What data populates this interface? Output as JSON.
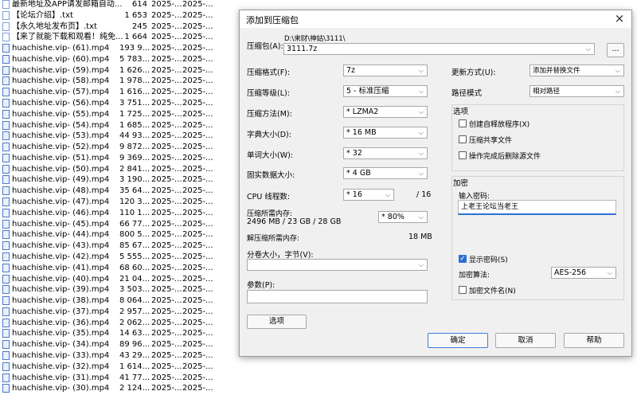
{
  "files": [
    {
      "name": "最新地址及APP请发邮箱自动...",
      "size": "614",
      "date": "2025-...",
      "date2": "2025-...",
      "type": "txt"
    },
    {
      "name": "【论坛介绍】.txt",
      "size": "1 653",
      "date": "2025-...",
      "date2": "2025-...",
      "type": "txt"
    },
    {
      "name": "【永久地址发布页】.txt",
      "size": "245",
      "date": "2025-...",
      "date2": "2025-...",
      "type": "txt"
    },
    {
      "name": "【来了就能下载和观看！纯免...",
      "size": "1 664",
      "date": "2025-...",
      "date2": "2025-...",
      "type": "txt"
    },
    {
      "name": "huachishe.vip- (61).mp4",
      "size": "193 9...",
      "date": "2025-...",
      "date2": "2025-...",
      "type": "mp4"
    },
    {
      "name": "huachishe.vip- (60).mp4",
      "size": "5 783...",
      "date": "2025-...",
      "date2": "2025-...",
      "type": "mp4"
    },
    {
      "name": "huachishe.vip- (59).mp4",
      "size": "1 626...",
      "date": "2025-...",
      "date2": "2025-...",
      "type": "mp4"
    },
    {
      "name": "huachishe.vip- (58).mp4",
      "size": "1 978...",
      "date": "2025-...",
      "date2": "2025-...",
      "type": "mp4"
    },
    {
      "name": "huachishe.vip- (57).mp4",
      "size": "1 616...",
      "date": "2025-...",
      "date2": "2025-...",
      "type": "mp4"
    },
    {
      "name": "huachishe.vip- (56).mp4",
      "size": "3 751...",
      "date": "2025-...",
      "date2": "2025-...",
      "type": "mp4"
    },
    {
      "name": "huachishe.vip- (55).mp4",
      "size": "1 725...",
      "date": "2025-...",
      "date2": "2025-...",
      "type": "mp4"
    },
    {
      "name": "huachishe.vip- (54).mp4",
      "size": "1 685...",
      "date": "2025-...",
      "date2": "2025-...",
      "type": "mp4"
    },
    {
      "name": "huachishe.vip- (53).mp4",
      "size": "44 93...",
      "date": "2025-...",
      "date2": "2025-...",
      "type": "mp4"
    },
    {
      "name": "huachishe.vip- (52).mp4",
      "size": "9 872...",
      "date": "2025-...",
      "date2": "2025-...",
      "type": "mp4"
    },
    {
      "name": "huachishe.vip- (51).mp4",
      "size": "9 369...",
      "date": "2025-...",
      "date2": "2025-...",
      "type": "mp4"
    },
    {
      "name": "huachishe.vip- (50).mp4",
      "size": "2 841...",
      "date": "2025-...",
      "date2": "2025-...",
      "type": "mp4"
    },
    {
      "name": "huachishe.vip- (49).mp4",
      "size": "3 190...",
      "date": "2025-...",
      "date2": "2025-...",
      "type": "mp4"
    },
    {
      "name": "huachishe.vip- (48).mp4",
      "size": "35 64...",
      "date": "2025-...",
      "date2": "2025-...",
      "type": "mp4"
    },
    {
      "name": "huachishe.vip- (47).mp4",
      "size": "120 3...",
      "date": "2025-...",
      "date2": "2025-...",
      "type": "mp4"
    },
    {
      "name": "huachishe.vip- (46).mp4",
      "size": "110 1...",
      "date": "2025-...",
      "date2": "2025-...",
      "type": "mp4"
    },
    {
      "name": "huachishe.vip- (45).mp4",
      "size": "66 77...",
      "date": "2025-...",
      "date2": "2025-...",
      "type": "mp4"
    },
    {
      "name": "huachishe.vip- (44).mp4",
      "size": "800 5...",
      "date": "2025-...",
      "date2": "2025-...",
      "type": "mp4"
    },
    {
      "name": "huachishe.vip- (43).mp4",
      "size": "85 67...",
      "date": "2025-...",
      "date2": "2025-...",
      "type": "mp4"
    },
    {
      "name": "huachishe.vip- (42).mp4",
      "size": "5 555...",
      "date": "2025-...",
      "date2": "2025-...",
      "type": "mp4"
    },
    {
      "name": "huachishe.vip- (41).mp4",
      "size": "68 60...",
      "date": "2025-...",
      "date2": "2025-...",
      "type": "mp4"
    },
    {
      "name": "huachishe.vip- (40).mp4",
      "size": "21 04...",
      "date": "2025-...",
      "date2": "2025-...",
      "type": "mp4"
    },
    {
      "name": "huachishe.vip- (39).mp4",
      "size": "3 503...",
      "date": "2025-...",
      "date2": "2025-...",
      "type": "mp4"
    },
    {
      "name": "huachishe.vip- (38).mp4",
      "size": "8 064...",
      "date": "2025-...",
      "date2": "2025-...",
      "type": "mp4"
    },
    {
      "name": "huachishe.vip- (37).mp4",
      "size": "2 957...",
      "date": "2025-...",
      "date2": "2025-...",
      "type": "mp4"
    },
    {
      "name": "huachishe.vip- (36).mp4",
      "size": "2 062...",
      "date": "2025-...",
      "date2": "2025-...",
      "type": "mp4"
    },
    {
      "name": "huachishe.vip- (35).mp4",
      "size": "14 63...",
      "date": "2025-...",
      "date2": "2025-...",
      "type": "mp4"
    },
    {
      "name": "huachishe.vip- (34).mp4",
      "size": "89 96...",
      "date": "2025-...",
      "date2": "2025-...",
      "type": "mp4"
    },
    {
      "name": "huachishe.vip- (33).mp4",
      "size": "43 29...",
      "date": "2025-...",
      "date2": "2025-...",
      "type": "mp4"
    },
    {
      "name": "huachishe.vip- (32).mp4",
      "size": "1 614...",
      "date": "2025-...",
      "date2": "2025-...",
      "type": "mp4"
    },
    {
      "name": "huachishe.vip- (31).mp4",
      "size": "41 77...",
      "date": "2025-...",
      "date2": "2025-...",
      "type": "mp4"
    },
    {
      "name": "huachishe.vip- (30).mp4",
      "size": "2 124...",
      "date": "2025-...",
      "date2": "2025-...",
      "type": "mp4"
    }
  ],
  "dialog": {
    "title": "添加到压缩包",
    "close_icon": "×",
    "archive_label": "压缩包(A):",
    "archive_path": "D:\\来财\\神姑\\3111\\",
    "archive_name": "3111.7z",
    "browse_label": "...",
    "format_label": "压缩格式(F):",
    "format_value": "7z",
    "level_label": "压缩等级(L):",
    "level_value": "5 - 标准压缩",
    "method_label": "压缩方法(M):",
    "method_value": "*  LZMA2",
    "dict_label": "字典大小(D):",
    "dict_value": "*  16 MB",
    "word_label": "单词大小(W):",
    "word_value": "*  32",
    "solid_label": "固实数据大小:",
    "solid_value": "*  4 GB",
    "cpu_label": "CPU 线程数:",
    "cpu_value": "*  16",
    "cpu_total": "/ 16",
    "mem_label": "压缩所需内存:",
    "mem_value": "2496 MB / 23 GB / 28 GB",
    "mem_percent": "* 80%",
    "decomp_label": "解压缩所需内存:",
    "decomp_value": "18 MB",
    "split_label": "分卷大小，字节(V):",
    "split_value": "",
    "params_label": "参数(P):",
    "params_value": "",
    "options_button": "选项",
    "update_label": "更新方式(U):",
    "update_value": "添加并替换文件",
    "path_label": "路径模式",
    "path_value": "相对路径",
    "options_group": "选项",
    "opt_sfx": "创建自释放程序(X)",
    "opt_shared": "压缩共享文件",
    "opt_delete": "操作完成后删除源文件",
    "encrypt_group": "加密",
    "password_label": "输入密码:",
    "password_value": "上老王论坛当老王",
    "show_password": "显示密码(S)",
    "enc_method_label": "加密算法:",
    "enc_method_value": "AES-256",
    "enc_names": "加密文件名(N)",
    "ok": "确定",
    "cancel": "取消",
    "help": "帮助",
    "checkmark": "✓",
    "dropdown_arrow": "⌵"
  }
}
